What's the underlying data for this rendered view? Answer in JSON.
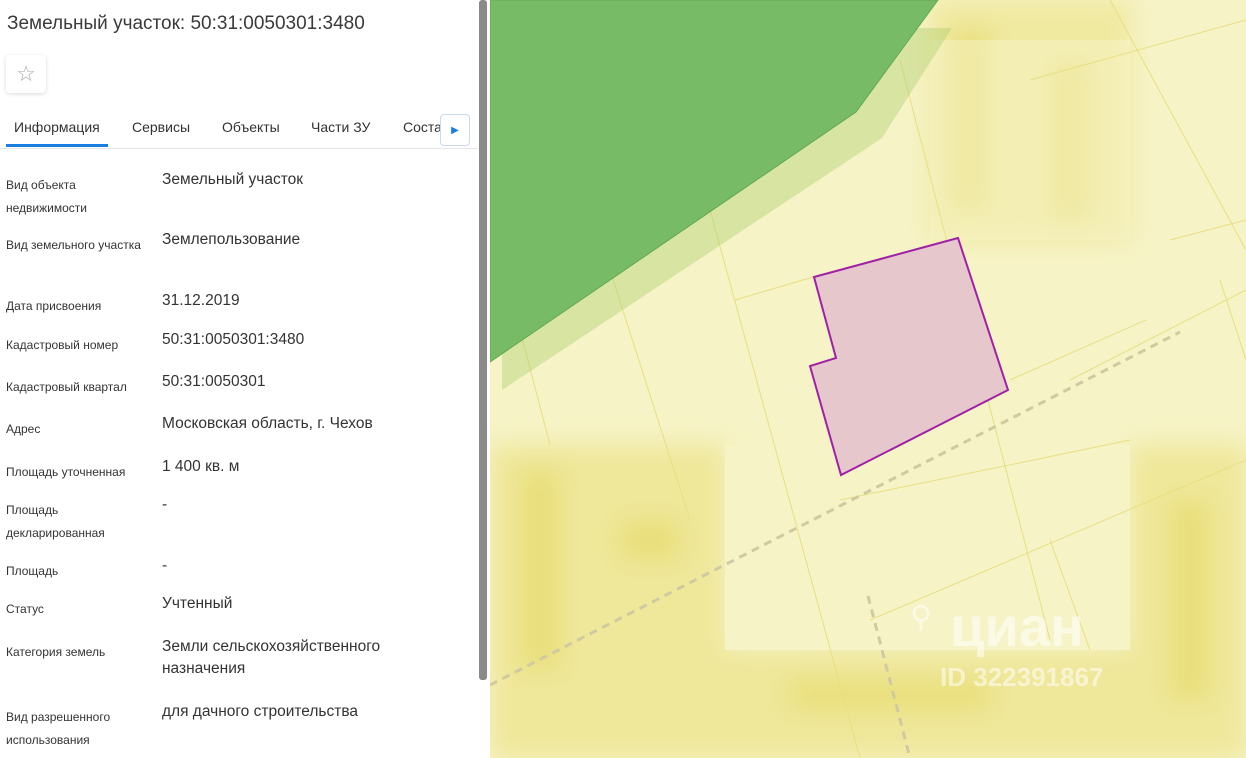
{
  "title": "Земельный участок: 50:31:0050301:3480",
  "favorite_icon": "star-outline-icon",
  "tabs": [
    "Информация",
    "Сервисы",
    "Объекты",
    "Части ЗУ",
    "Состав"
  ],
  "tab_next_icon": "caret-right-icon",
  "fields": [
    {
      "label": "Вид объекта недвижимости",
      "value": "Земельный участок"
    },
    {
      "label": "Вид земельного участка",
      "value": "Землепользование"
    },
    {
      "label": "Дата присвоения",
      "value": "31.12.2019"
    },
    {
      "label": "Кадастровый номер",
      "value": "50:31:0050301:3480"
    },
    {
      "label": "Кадастровый квартал",
      "value": "50:31:0050301"
    },
    {
      "label": "Адрес",
      "value": "Московская область, г. Чехов"
    },
    {
      "label": "Площадь уточненная",
      "value": "1 400 кв. м"
    },
    {
      "label": "Площадь декларированная",
      "value": "-"
    },
    {
      "label": "Площадь",
      "value": "-"
    },
    {
      "label": "Статус",
      "value": "Учтенный"
    },
    {
      "label": "Категория земель",
      "value": "Земли сельскохозяйственного назначения"
    },
    {
      "label": "Вид разрешенного использования",
      "value": "для дачного строительства"
    }
  ],
  "watermark": {
    "brand": "циан",
    "id": "ID 322391867"
  },
  "colors": {
    "accent": "#1a7fe0",
    "parcel_fill": "#e6c8cc",
    "parcel_stroke": "#a020a8",
    "forest": "#78bb66",
    "map_bg": "#f6f3c6"
  }
}
